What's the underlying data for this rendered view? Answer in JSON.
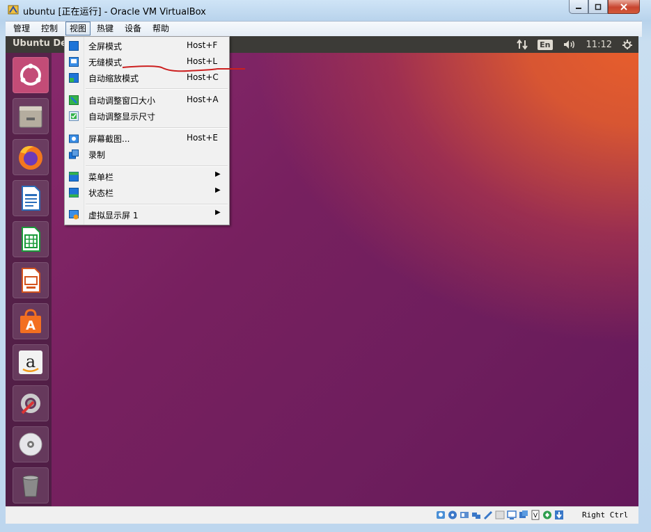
{
  "window": {
    "title": "ubuntu [正在运行] - Oracle VM VirtualBox",
    "minimize_icon": "minimize-icon",
    "maximize_icon": "maximize-icon",
    "close_icon": "close-icon"
  },
  "menubar": {
    "items": [
      "管理",
      "控制",
      "视图",
      "热键",
      "设备",
      "帮助"
    ],
    "active": "视图"
  },
  "guest": {
    "topbar_title": "Ubuntu De",
    "keyboard_layout": "En",
    "clock": "11:12"
  },
  "view_menu": {
    "items": [
      {
        "label": "全屏模式",
        "shortcut": "Host+F"
      },
      {
        "label": "无缝模式",
        "shortcut": "Host+L"
      },
      {
        "label": "自动缩放模式",
        "shortcut": "Host+C"
      },
      {
        "label": "自动调整窗口大小",
        "shortcut": "Host+A"
      },
      {
        "label": "自动调整显示尺寸",
        "shortcut": ""
      },
      {
        "label": "屏幕截图...",
        "shortcut": "Host+E"
      },
      {
        "label": "录制",
        "shortcut": ""
      },
      {
        "label": "菜单栏",
        "shortcut": ""
      },
      {
        "label": "状态栏",
        "shortcut": ""
      },
      {
        "label": "虚拟显示屏 1",
        "shortcut": ""
      }
    ]
  },
  "launcher": {
    "apps": [
      "ubuntu-dash-icon",
      "files-icon",
      "firefox-icon",
      "writer-icon",
      "calc-icon",
      "impress-icon",
      "software-center-icon",
      "amazon-icon",
      "system-settings-icon",
      "dvd-icon",
      "trash-icon"
    ]
  },
  "statusbar": {
    "host_key": "Right Ctrl"
  },
  "colors": {
    "annotation": "#cc1f1f",
    "ubuntu_orange": "#e95420",
    "topbar": "#3c3b37"
  }
}
